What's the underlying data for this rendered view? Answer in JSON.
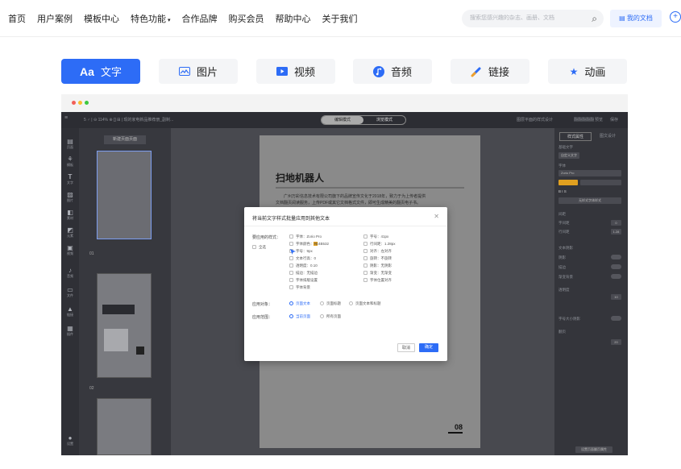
{
  "nav": {
    "links": [
      "首页",
      "用户案例",
      "模板中心",
      "特色功能",
      "合作品牌",
      "购买会员",
      "帮助中心",
      "关于我们"
    ],
    "dropdown_caret": "▾",
    "search_placeholder": "搜索您感兴趣的杂志、画册、文档",
    "my_docs": "我的文档"
  },
  "feature_tabs": [
    {
      "icon": "Aa",
      "label": "文字",
      "active": true
    },
    {
      "icon": "image-icon",
      "label": "图片"
    },
    {
      "icon": "video-icon",
      "label": "视频"
    },
    {
      "icon": "music-note-icon",
      "label": "音频"
    },
    {
      "icon": "link-icon",
      "label": "链接"
    },
    {
      "icon": "star-icon",
      "label": "动画"
    }
  ],
  "editor": {
    "toolbar_text": "5 ♂ | ⊖ 114% ⊕ [] ⊞ | 现的家电新品推荐册_副制...",
    "mode_left": "编辑模式",
    "mode_right": "浏览模式",
    "right_tools": [
      "图层平面的样式设计",
      "翻翻翻翻翻",
      "预览",
      "保存"
    ],
    "left_tools": [
      "页面",
      "模板",
      "文字",
      "图片",
      "素材",
      "元素",
      "视频",
      "音频",
      "文件",
      "链接",
      "插件",
      "设置"
    ],
    "thumb_button": "新建页面页面",
    "thumb_numbers": [
      "01",
      "02"
    ],
    "page_title": "扫地机器人",
    "page_text": [
      "广州万彩信息技术有限公司旗下的品牌宣传文化于2018年，致力于为上传者提供",
      "文档翻页阅读服务，上传PDF或其它文档格式文件，即可生成精美的翻页电子书。"
    ],
    "page_number": "08",
    "rp_tabs": [
      "样式属性",
      "图文设计"
    ],
    "rp_rows": [
      "基础文字",
      "自定义文字",
      "字体",
      "Zorio Pro",
      "B I S",
      "无样式字体样式",
      "间距",
      "字间距",
      "行间距",
      "文本阴影",
      "阴影",
      "描边",
      "渐变背景",
      "透明度",
      "旋转",
      "渐变",
      "字号大小阴影",
      "翻页"
    ],
    "rp_values": [
      "0",
      "1.28",
      "10",
      "20"
    ],
    "bottom_label": "设置页面翻页属性"
  },
  "modal": {
    "title": "将当前文字样式批量应用到其他文本",
    "close": "✕",
    "section_label": "要应用的样式：",
    "all_label": "全选",
    "options_left": [
      "字体：Zorio Pro",
      "字体颜色：#E4B532",
      "字号：9px",
      "文本行高：0",
      "透明度：0.10",
      "描边：无描边",
      "字体排版设置",
      "字体背景"
    ],
    "options_right": [
      "字号：41px",
      "行间距：1.28px",
      "对齐：左对齐",
      "旋转：不旋转",
      "阴影：无阴影",
      "渐变：无渐变",
      "字体位置对齐"
    ],
    "scope_label": "应用对象：",
    "scope_options": [
      "页面文本",
      "页面标题",
      "页面文本和标题"
    ],
    "range_label": "应用范围：",
    "range_options": [
      "当前页面",
      "所有页面"
    ],
    "cancel": "取消",
    "confirm": "确定"
  },
  "colors": {
    "accent": "#2d6cf6",
    "swatch": "#e0a020"
  }
}
